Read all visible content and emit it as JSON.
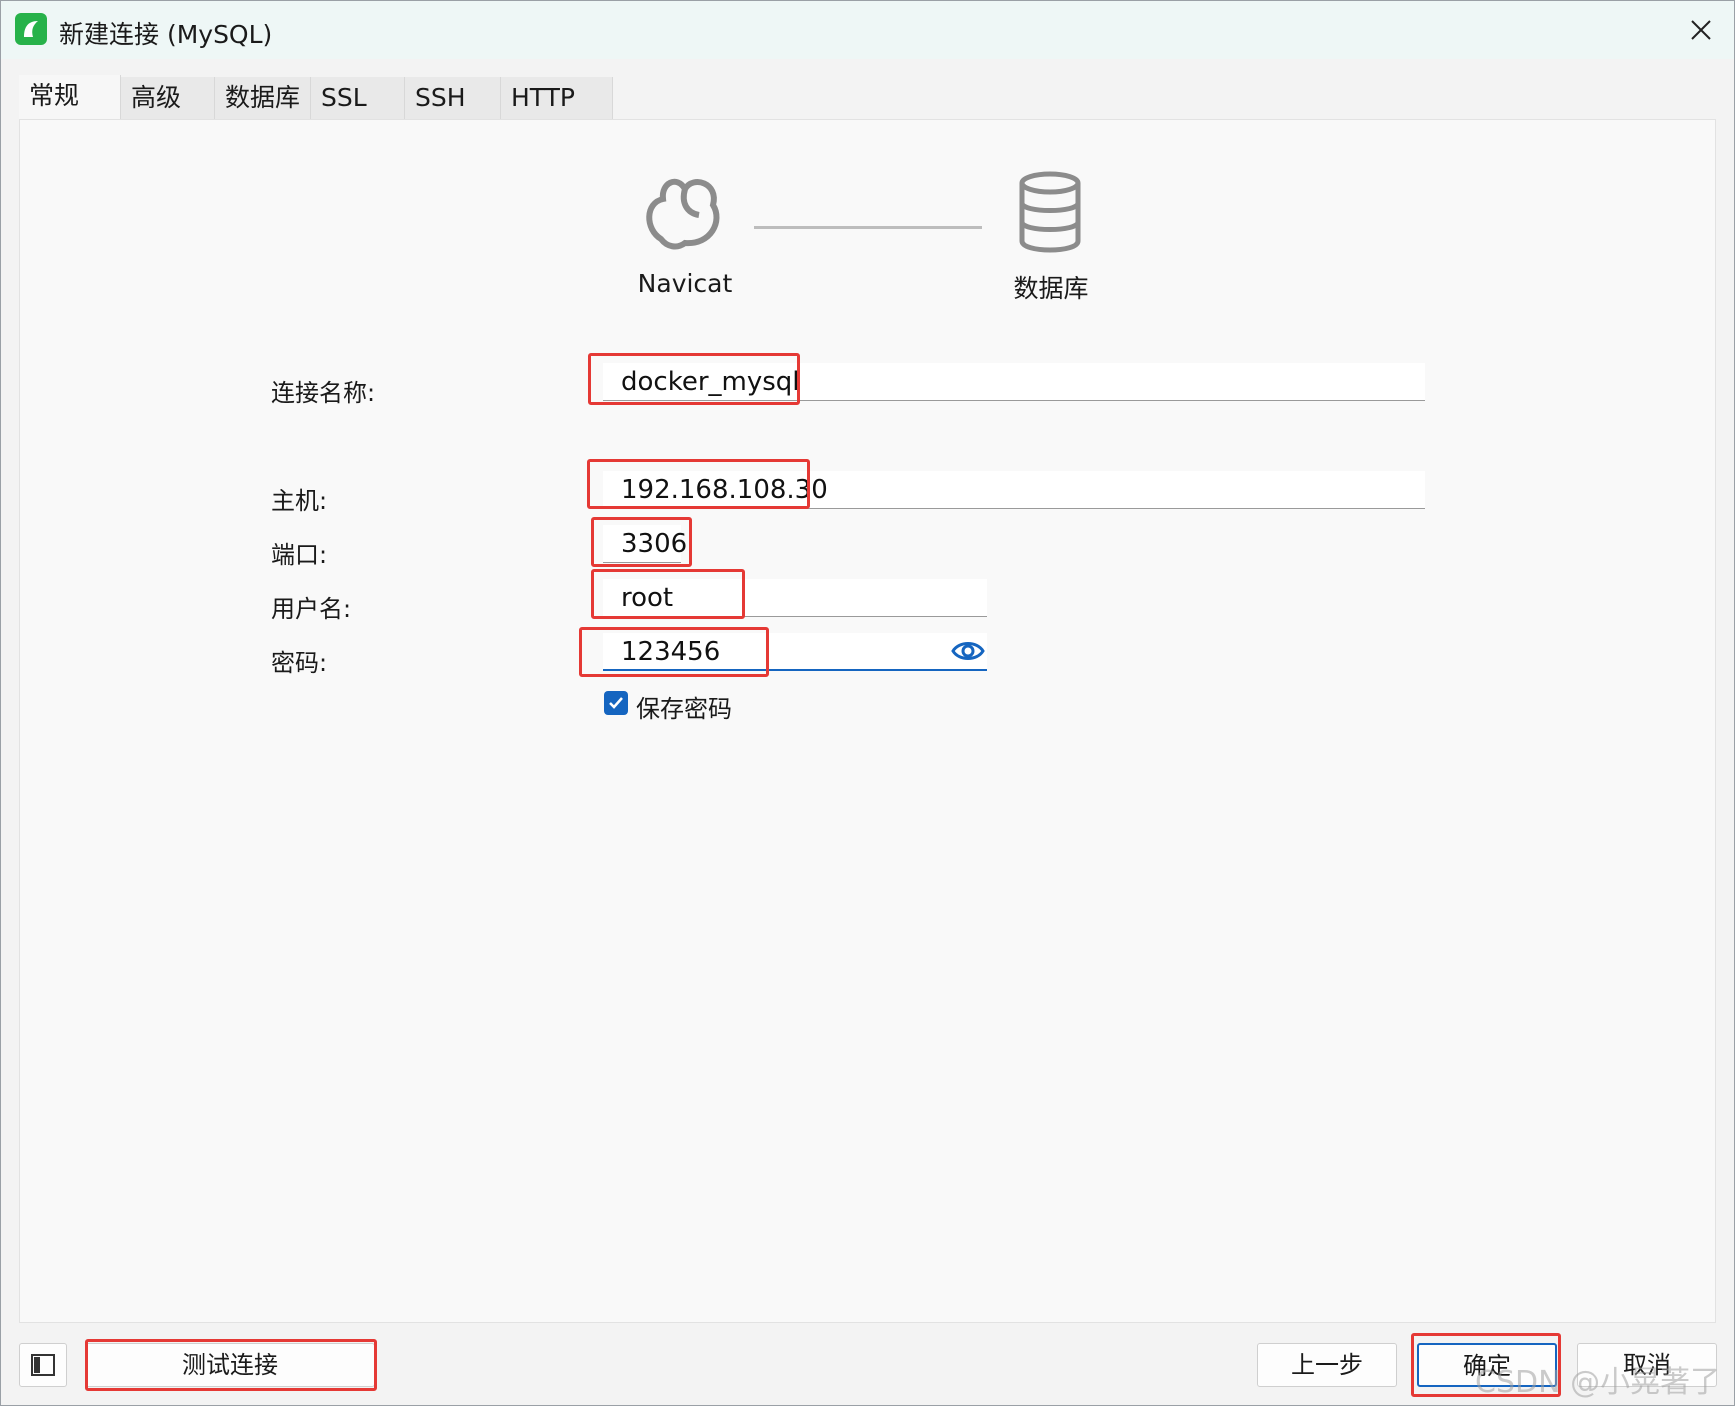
{
  "window": {
    "title": "新建连接 (MySQL)",
    "accent_color": "#1565c0",
    "highlight_color": "#e53935",
    "brand_color": "#27b24a"
  },
  "tabs": [
    {
      "label": "常规",
      "active": true
    },
    {
      "label": "高级",
      "active": false
    },
    {
      "label": "数据库",
      "active": false
    },
    {
      "label": "SSL",
      "active": false
    },
    {
      "label": "SSH",
      "active": false
    },
    {
      "label": "HTTP",
      "active": false
    }
  ],
  "diagram": {
    "left_label": "Navicat",
    "right_label": "数据库",
    "left_icon": "navicat-logo-icon",
    "right_icon": "database-icon"
  },
  "form": {
    "connection_name": {
      "label": "连接名称:",
      "value": "docker_mysql"
    },
    "host": {
      "label": "主机:",
      "value": "192.168.108.30"
    },
    "port": {
      "label": "端口:",
      "value": "3306"
    },
    "username": {
      "label": "用户名:",
      "value": "root"
    },
    "password": {
      "label": "密码:",
      "value": "123456"
    },
    "save_password": {
      "label": "保存密码",
      "checked": true
    }
  },
  "footer": {
    "test_connection": "测试连接",
    "previous": "上一步",
    "ok": "确定",
    "cancel": "取消"
  },
  "watermark": "CSDN @小晃著了"
}
